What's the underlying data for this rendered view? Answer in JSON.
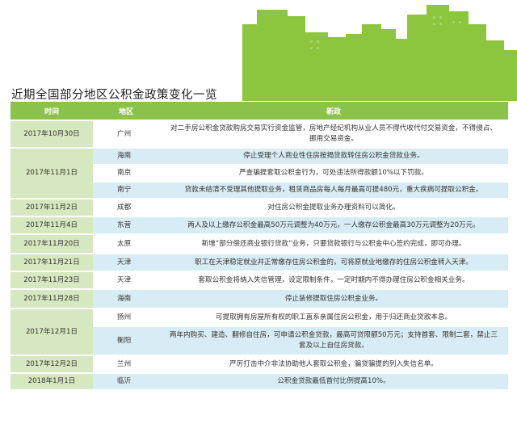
{
  "title": "近期全国部分地区公积金政策变化一览",
  "colors": {
    "header": "#8bc34a",
    "time_cell": "#d6e8bf",
    "row_alt": "#d8ecf5",
    "skyline": "#8cc63f"
  },
  "table": {
    "headers": [
      "时间",
      "地区",
      "新政"
    ],
    "rows": [
      {
        "time": "2017年10月30日",
        "time_rowspan": 1,
        "region": "广州",
        "policy": "对二手房公积金贷款购房交易实行资金监管，房地产经纪机构从业人员不得代收代付交易资金，不得侵占、挪用交易资金。",
        "shade": "g",
        "height": 34
      },
      {
        "time": "2017年11月1日",
        "time_rowspan": 3,
        "region": "海南",
        "policy": "停止受理个人商业性住房按揭贷款转住房公积金贷款业务。",
        "shade": "b",
        "height": 20
      },
      {
        "time": "",
        "time_rowspan": 0,
        "region": "南京",
        "policy": "严查骗提套取公积金行为，可处违法所得款额10%以下罚款。",
        "shade": "g",
        "height": 20
      },
      {
        "time": "",
        "time_rowspan": 0,
        "region": "南宁",
        "policy": "贷款未结清不受理其他提取业务，租赁商品房每人每月最高可提480元，重大疾病可提取公积金。",
        "shade": "b",
        "height": 20
      },
      {
        "time": "2017年11月2日",
        "time_rowspan": 1,
        "region": "成都",
        "policy": "对住房公积金提取业务办理资料可以简化。",
        "shade": "g",
        "height": 22
      },
      {
        "time": "2017年11月4日",
        "time_rowspan": 1,
        "region": "东营",
        "policy": "两人及以上缴存公积金最高50万元调整为40万元，一人缴存公积金最高30万元调整为20万元。",
        "shade": "b",
        "height": 22
      },
      {
        "time": "2017年11月20日",
        "time_rowspan": 1,
        "region": "太原",
        "policy": "新增“部分偿还商业银行贷款”业务，只要贷款银行与公积金中心签约完成，即可办理。",
        "shade": "g",
        "height": 24
      },
      {
        "time": "2017年11月21日",
        "time_rowspan": 1,
        "region": "天津",
        "policy": "职工在天津稳定就业并正常缴存住房公积金的，可将原就业地缴存的住房公积金转入天津。",
        "shade": "b",
        "height": 22
      },
      {
        "time": "2017年11月23日",
        "time_rowspan": 1,
        "region": "天津",
        "policy": "套取公积金将纳入失信管理，设定限制条件，一定时期内不得办理住房公积金相关业务。",
        "shade": "g",
        "height": 22
      },
      {
        "time": "2017年11月28日",
        "time_rowspan": 1,
        "region": "海南",
        "policy": "停止装修提取住房公积金业务。",
        "shade": "b",
        "height": 24
      },
      {
        "time": "2017年12月1日",
        "time_rowspan": 2,
        "region": "扬州",
        "policy": "可提取拥有房屋所有权的职工直系亲属住房公积金，用于归还商业贷款本息。",
        "shade": "g",
        "height": 22
      },
      {
        "time": "",
        "time_rowspan": 0,
        "region": "衡阳",
        "policy": "两年内购买、建造、翻修自住房，可申请公积金贷款，最高可贷限额50万元；支持首套、限制二套，禁止三套及以上自住房贷款。",
        "shade": "b",
        "height": 36
      },
      {
        "time": "2017年12月2日",
        "time_rowspan": 1,
        "region": "兰州",
        "policy": "严厉打击中介非法协助他人套取公积金，骗贷骗提的列入失信名单。",
        "shade": "g",
        "height": 22
      },
      {
        "time": "2018年1月1日",
        "time_rowspan": 1,
        "region": "临沂",
        "policy": "公积金贷款最低首付比例提高10%。",
        "shade": "b",
        "height": 20
      }
    ]
  }
}
